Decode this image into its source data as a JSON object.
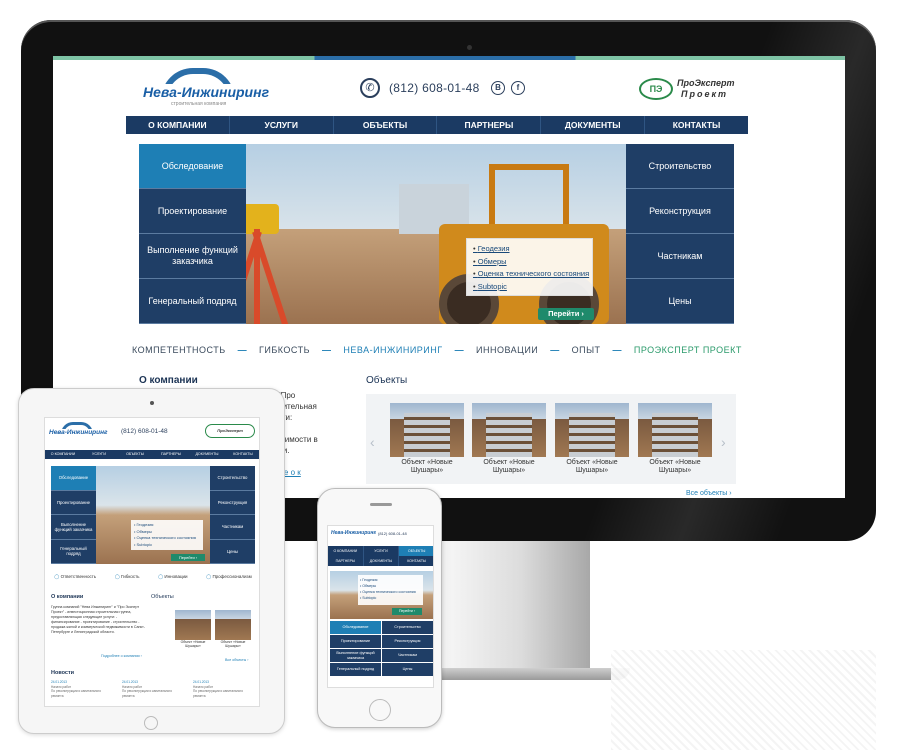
{
  "desktop": {
    "logo_text": "Нева-Инжиниринг",
    "logo_sub": "строительная компания",
    "phone_icon": "phone-icon",
    "phone": "(812) 608-01-48",
    "social": [
      "B",
      "f"
    ],
    "partner_logo": {
      "mark": "ПЭ",
      "line1": "ПроЭксперт",
      "line2": "Проект"
    },
    "menu": [
      "О КОМПАНИИ",
      "УСЛУГИ",
      "ОБЪЕКТЫ",
      "ПАРТНЕРЫ",
      "ДОКУМЕНТЫ",
      "КОНТАКТЫ"
    ],
    "hero_left": [
      "Обследование",
      "Проектирование",
      "Выполнение функций заказчика",
      "Генеральный подряд"
    ],
    "hero_right": [
      "Строительство",
      "Реконструкция",
      "Частникам",
      "Цены"
    ],
    "popup": [
      "Геодезия",
      "Обмеры",
      "Оценка технического состояния",
      "Subtopic"
    ],
    "go_button": "Перейти",
    "go_arrow": "›",
    "slogan": {
      "compet": "КОМПЕТЕНТНОСТЬ",
      "flex": "ГИБКОСТЬ",
      "neva": "НЕВА-ИНЖИНИРИНГ",
      "innov": "ИННОВАЦИИ",
      "exp": "ОПЫТ",
      "pro": "ПРОЭКСПЕРТ ПРОЕКТ",
      "sep": "—"
    },
    "about_title": "О компании",
    "about_text_1": "\" и \"Про",
    "about_text_2": "строительная",
    "about_text_3": "услуги:",
    "about_text_4": "движимости в",
    "about_text_5": "ласти.",
    "about_more": "обнее о к",
    "objects_title": "Объекты",
    "objects": [
      {
        "label": "Объект «Новые Шушары»"
      },
      {
        "label": "Объект «Новые Шушары»"
      },
      {
        "label": "Объект «Новые Шушары»"
      },
      {
        "label": "Объект «Новые Шушары»"
      }
    ],
    "arrow_prev": "‹",
    "arrow_next": "›",
    "all_objects": "Все объекты ›"
  },
  "tablet": {
    "phone": "(812) 608-01-48",
    "menu": [
      "О КОМПАНИИ",
      "УСЛУГИ",
      "ОБЪЕКТЫ",
      "ПАРТНЕРЫ",
      "ДОКУМЕНТЫ",
      "КОНТАКТЫ"
    ],
    "hero_left": [
      "Обследование",
      "Проектирование",
      "Выполнение функций заказчика",
      "Генеральный подряд"
    ],
    "hero_right": [
      "Строительство",
      "Реконструкция",
      "Частникам",
      "Цены"
    ],
    "popup": [
      "• Геодезия",
      "• Обмеры",
      "• Оценка технического состояния",
      "• Subtopic"
    ],
    "go_button": "Перейти ›",
    "features": [
      "Ответственность",
      "Гибкость",
      "Инновации",
      "Профессионализм"
    ],
    "about_title": "О компании",
    "about_text": "Группа компаний \"Нева Инжиниринг\" и \"Про Эксперт Проект\" - инвестиционная строительная группа, предоставляющая следующие услуги: - финансирование - проектирование - строительство - продажа жилой и коммерческой недвижимости в Санкт-Петербурге и Ленинградской области.",
    "about_more": "Подробнее о компании ›",
    "objects_title": "Объекты",
    "object_label": "Объект «Новые Шушары»",
    "all_objects": "Все объекты ›",
    "news_title": "Новости",
    "news": [
      {
        "date": "24.01.2013",
        "title": "Начато работ",
        "text": "По реконструкции и капитального ремонта"
      },
      {
        "date": "24.01.2013",
        "title": "Начато работ",
        "text": "По реконструкции и капитального ремонта"
      },
      {
        "date": "24.01.2013",
        "title": "Начато работ",
        "text": "По реконструкции и капитального ремонта"
      }
    ]
  },
  "phone": {
    "phone": "(812) 608-01-48",
    "menu_row1": [
      "О КОМПАНИИ",
      "УСЛУГИ",
      "ОБЪЕКТЫ"
    ],
    "menu_row2": [
      "ПАРТНЕРЫ",
      "ДОКУМЕНТЫ",
      "КОНТАКТЫ"
    ],
    "popup": [
      "• Геодезия",
      "• Обмеры",
      "• Оценка технического состояния",
      "• Subtopic"
    ],
    "go_button": "Перейти ›",
    "grid": [
      "Обследование",
      "Строительство",
      "Проектирование",
      "Реконструкция",
      "Выполнение функций заказчика",
      "Частникам",
      "Генеральный подряд",
      "Цены"
    ]
  },
  "colors": {
    "brand_navy": "#1b3a63",
    "brand_blue": "#1e7fb5",
    "brand_green": "#1f8a6b"
  }
}
